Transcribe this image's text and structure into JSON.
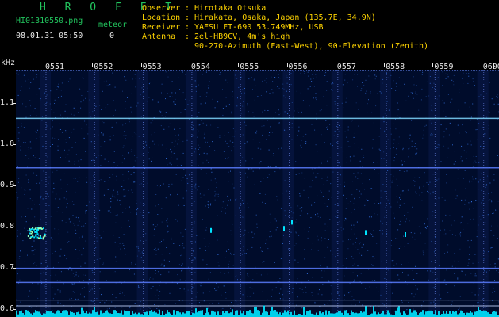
{
  "header": {
    "logo": "H R O F F T",
    "filename": "HI01310550.png",
    "meteor_label": "meteor",
    "datetime": "08.01.31 05:50",
    "meteor_count": "0",
    "observer_label": "Observer",
    "observer_value": "Hirotaka Otsuka",
    "location_label": "Location",
    "location_value": "Hirakata, Osaka, Japan (135.7E, 34.9N)",
    "receiver_label": "Receiver",
    "receiver_value": "YAESU FT-690 53.749MHz, USB",
    "antenna_label": "Antenna",
    "antenna_value": "2el-HB9CV, 4m's high",
    "antenna_value2": "90-270-Azimuth (East-West), 90-Elevation (Zenith)",
    "separator": ":"
  },
  "plot": {
    "y_unit": "kHz",
    "y_ticks": [
      "1.1",
      "1.0",
      "0.9",
      "0.8",
      "0.7",
      "0.6"
    ],
    "y_tick_values": [
      1.1,
      1.0,
      0.9,
      0.8,
      0.7,
      0.6
    ],
    "y_range": [
      0.58,
      1.18
    ],
    "time_labels": [
      "0551",
      "0552",
      "0553",
      "0554",
      "0555",
      "0556",
      "0557",
      "0558",
      "0559",
      "0600"
    ],
    "time_range": [
      0,
      10
    ],
    "colors": {
      "background": "#000c2b",
      "grid": "#ffffff",
      "signal": "#3b82ff",
      "strong": "#00e5ff",
      "meteor": "#9dffb0"
    },
    "carrier_lines_khz": [
      1.062,
      0.942,
      0.698,
      0.664,
      0.621,
      0.607
    ]
  }
}
